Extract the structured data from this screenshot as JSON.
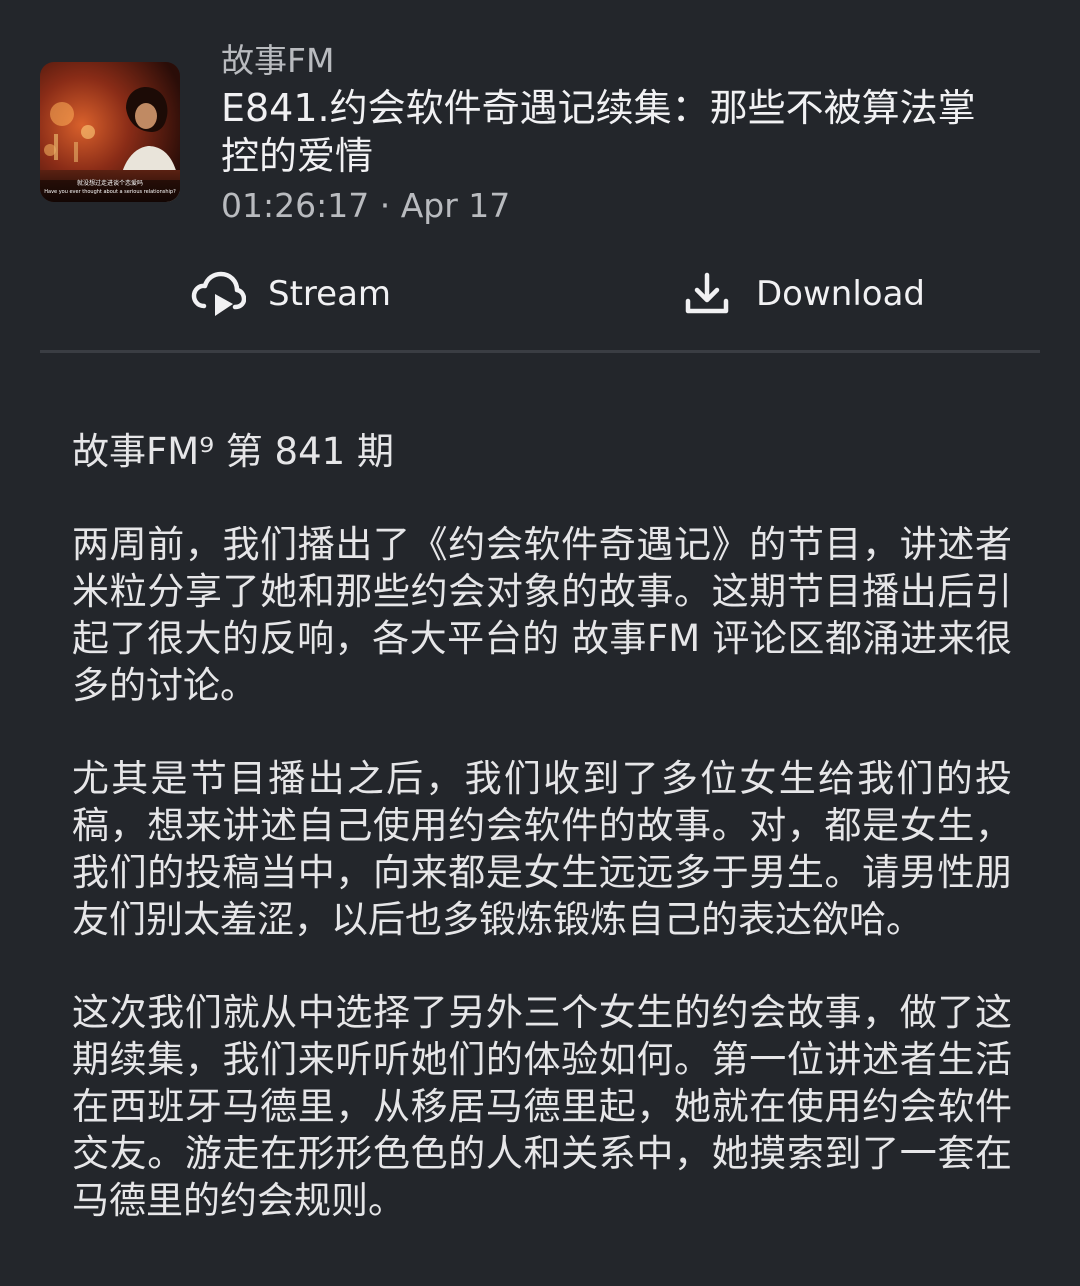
{
  "episode": {
    "podcast_name": "故事FM",
    "title": "E841.约会软件奇遇记续集：那些不被算法掌控的爱情",
    "duration": "01:26:17",
    "separator": " · ",
    "date": "Apr 17",
    "cover": {
      "subtitle_zh": "就没想过走进谈个恋爱吗",
      "subtitle_en": "Have you ever thought about a serious relationship?"
    }
  },
  "actions": {
    "stream_label": "Stream",
    "stream_icon": "cloud-play-icon",
    "download_label": "Download",
    "download_icon": "download-icon"
  },
  "description": {
    "heading": "故事FM⁹ 第 841 期",
    "paragraphs": [
      "两周前，我们播出了《约会软件奇遇记》的节目，讲述者米粒分享了她和那些约会对象的故事。这期节目播出后引起了很大的反响，各大平台的 故事FM 评论区都涌进来很多的讨论。",
      "尤其是节目播出之后，我们收到了多位女生给我们的投稿，想来讲述自己使用约会软件的故事。对，都是女生，我们的投稿当中，向来都是女生远远多于男生。请男性朋友们别太羞涩，以后也多锻炼锻炼自己的表达欲哈。",
      "这次我们就从中选择了另外三个女生的约会故事，做了这期续集，我们来听听她们的体验如何。第一位讲述者生活在西班牙马德里，从移居马德里起，她就在使用约会软件交友。游走在形形色色的人和关系中，她摸索到了一套在马德里的约会规则。"
    ]
  },
  "colors": {
    "background": "#23262b",
    "divider": "#3a3d43",
    "text_primary": "#f1f1f3",
    "text_secondary": "#b9bbbf"
  }
}
